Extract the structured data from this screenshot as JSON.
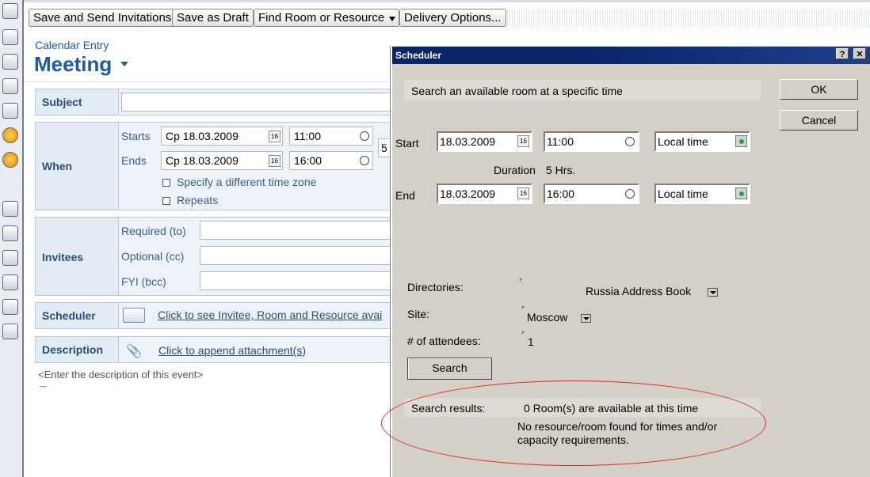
{
  "toolbar": {
    "save_send": "Save and Send Invitations",
    "save_draft": "Save as Draft",
    "find_room": "Find Room or Resource",
    "delivery": "Delivery Options..."
  },
  "header": {
    "form_type": "Calendar Entry",
    "entry_type": "Meeting"
  },
  "form": {
    "subject_label": "Subject",
    "subject_value": "",
    "when_label": "When",
    "starts_label": "Starts",
    "starts_date": "Ср 18.03.2009",
    "starts_time": "11:00",
    "ends_label": "Ends",
    "ends_date": "Ср 18.03.2009",
    "ends_time": "16:00",
    "duration_partial": "5",
    "tz_checkbox": "Specify a different time zone",
    "repeats_checkbox": "Repeats",
    "invitees_label": "Invitees",
    "required_label": "Required (to)",
    "optional_label": "Optional (cc)",
    "fyi_label": "FYI (bcc)",
    "scheduler_label": "Scheduler",
    "scheduler_link": "Click to see Invitee, Room and Resource avai",
    "description_label": "Description",
    "attach_link": "Click to append attachment(s)",
    "description_placeholder": "<Enter the description of this event>",
    "calendar_icon_text": "16"
  },
  "dialog": {
    "title": "Scheduler",
    "help_btn": "?",
    "close_btn": "✕",
    "ok": "OK",
    "cancel": "Cancel",
    "search_heading": "Search an available room at a specific time",
    "start_label": "Start",
    "start_date": "18.03.2009",
    "start_time": "11:00",
    "start_tz": "Local time",
    "duration_label": "Duration",
    "duration_value": "5 Hrs.",
    "end_label": "End",
    "end_date": "18.03.2009",
    "end_time": "16:00",
    "end_tz": "Local time",
    "directories_label": "Directories:",
    "directories_value": "Russia Address Book",
    "site_label": "Site:",
    "site_value": "Moscow",
    "attendees_label": "# of attendees:",
    "attendees_value": "1",
    "search_btn": "Search",
    "results_label": "Search results:",
    "results_count": "0 Room(s) are available at this time",
    "results_msg_line1": "No resource/room found for times and/or",
    "results_msg_line2": "capacity requirements.",
    "calendar_icon_text": "16"
  },
  "colors": {
    "accent": "#1d5ba6",
    "dialog_title": "#0a246a",
    "highlight_ellipse": "#e02020"
  }
}
